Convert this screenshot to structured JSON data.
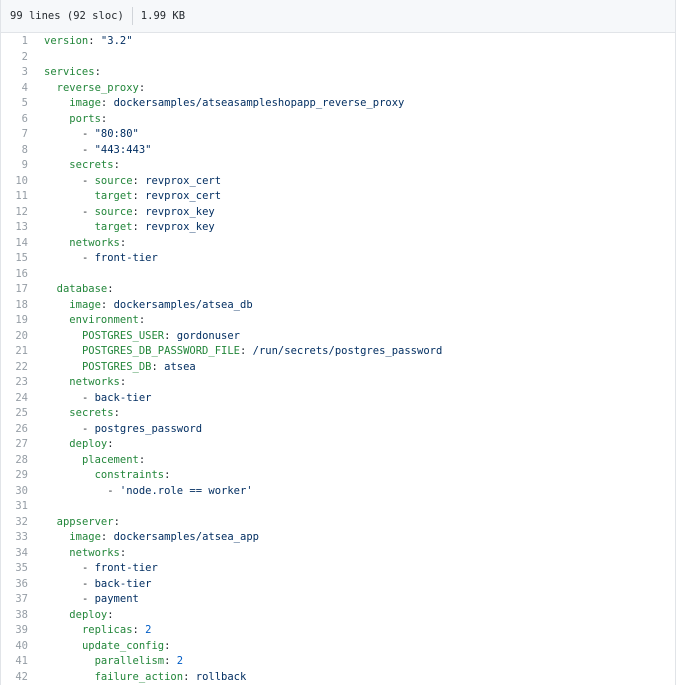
{
  "file_info": {
    "lines": "99 lines (92 sloc)",
    "size": "1.99 KB"
  },
  "colors": {
    "key": "#22863a",
    "string": "#032f62",
    "number": "#005cc5",
    "line_number": "#959da5",
    "header_bg": "#f6f8fa"
  },
  "lines": [
    {
      "n": "1",
      "indent": 0,
      "dash": false,
      "key": "version",
      "sep": ": ",
      "val": "\"3.2\"",
      "vt": "s"
    },
    {
      "n": "2",
      "indent": 0,
      "dash": false,
      "key": "",
      "sep": "",
      "val": "",
      "vt": "s"
    },
    {
      "n": "3",
      "indent": 0,
      "dash": false,
      "key": "services",
      "sep": ":",
      "val": "",
      "vt": "s"
    },
    {
      "n": "4",
      "indent": 2,
      "dash": false,
      "key": "reverse_proxy",
      "sep": ":",
      "val": "",
      "vt": "s"
    },
    {
      "n": "5",
      "indent": 4,
      "dash": false,
      "key": "image",
      "sep": ": ",
      "val": "dockersamples/atseasampleshopapp_reverse_proxy",
      "vt": "s"
    },
    {
      "n": "6",
      "indent": 4,
      "dash": false,
      "key": "ports",
      "sep": ":",
      "val": "",
      "vt": "s"
    },
    {
      "n": "7",
      "indent": 6,
      "dash": true,
      "key": "",
      "sep": "",
      "val": "\"80:80\"",
      "vt": "s"
    },
    {
      "n": "8",
      "indent": 6,
      "dash": true,
      "key": "",
      "sep": "",
      "val": "\"443:443\"",
      "vt": "s"
    },
    {
      "n": "9",
      "indent": 4,
      "dash": false,
      "key": "secrets",
      "sep": ":",
      "val": "",
      "vt": "s"
    },
    {
      "n": "10",
      "indent": 6,
      "dash": true,
      "key": "source",
      "sep": ": ",
      "val": "revprox_cert",
      "vt": "s"
    },
    {
      "n": "11",
      "indent": 8,
      "dash": false,
      "key": "target",
      "sep": ": ",
      "val": "revprox_cert",
      "vt": "s"
    },
    {
      "n": "12",
      "indent": 6,
      "dash": true,
      "key": "source",
      "sep": ": ",
      "val": "revprox_key",
      "vt": "s"
    },
    {
      "n": "13",
      "indent": 8,
      "dash": false,
      "key": "target",
      "sep": ": ",
      "val": "revprox_key",
      "vt": "s"
    },
    {
      "n": "14",
      "indent": 4,
      "dash": false,
      "key": "networks",
      "sep": ":",
      "val": "",
      "vt": "s"
    },
    {
      "n": "15",
      "indent": 6,
      "dash": true,
      "key": "",
      "sep": "",
      "val": "front-tier",
      "vt": "s"
    },
    {
      "n": "16",
      "indent": 0,
      "dash": false,
      "key": "",
      "sep": "",
      "val": "",
      "vt": "s"
    },
    {
      "n": "17",
      "indent": 2,
      "dash": false,
      "key": "database",
      "sep": ":",
      "val": "",
      "vt": "s"
    },
    {
      "n": "18",
      "indent": 4,
      "dash": false,
      "key": "image",
      "sep": ": ",
      "val": "dockersamples/atsea_db",
      "vt": "s"
    },
    {
      "n": "19",
      "indent": 4,
      "dash": false,
      "key": "environment",
      "sep": ":",
      "val": "",
      "vt": "s"
    },
    {
      "n": "20",
      "indent": 6,
      "dash": false,
      "key": "POSTGRES_USER",
      "sep": ": ",
      "val": "gordonuser",
      "vt": "s"
    },
    {
      "n": "21",
      "indent": 6,
      "dash": false,
      "key": "POSTGRES_DB_PASSWORD_FILE",
      "sep": ": ",
      "val": "/run/secrets/postgres_password",
      "vt": "s"
    },
    {
      "n": "22",
      "indent": 6,
      "dash": false,
      "key": "POSTGRES_DB",
      "sep": ": ",
      "val": "atsea",
      "vt": "s"
    },
    {
      "n": "23",
      "indent": 4,
      "dash": false,
      "key": "networks",
      "sep": ":",
      "val": "",
      "vt": "s"
    },
    {
      "n": "24",
      "indent": 6,
      "dash": true,
      "key": "",
      "sep": "",
      "val": "back-tier",
      "vt": "s"
    },
    {
      "n": "25",
      "indent": 4,
      "dash": false,
      "key": "secrets",
      "sep": ":",
      "val": "",
      "vt": "s"
    },
    {
      "n": "26",
      "indent": 6,
      "dash": true,
      "key": "",
      "sep": "",
      "val": "postgres_password",
      "vt": "s"
    },
    {
      "n": "27",
      "indent": 4,
      "dash": false,
      "key": "deploy",
      "sep": ":",
      "val": "",
      "vt": "s"
    },
    {
      "n": "28",
      "indent": 6,
      "dash": false,
      "key": "placement",
      "sep": ":",
      "val": "",
      "vt": "s"
    },
    {
      "n": "29",
      "indent": 8,
      "dash": false,
      "key": "constraints",
      "sep": ":",
      "val": "",
      "vt": "s"
    },
    {
      "n": "30",
      "indent": 10,
      "dash": true,
      "key": "",
      "sep": "",
      "val": "'node.role == worker'",
      "vt": "s"
    },
    {
      "n": "31",
      "indent": 0,
      "dash": false,
      "key": "",
      "sep": "",
      "val": "",
      "vt": "s"
    },
    {
      "n": "32",
      "indent": 2,
      "dash": false,
      "key": "appserver",
      "sep": ":",
      "val": "",
      "vt": "s"
    },
    {
      "n": "33",
      "indent": 4,
      "dash": false,
      "key": "image",
      "sep": ": ",
      "val": "dockersamples/atsea_app",
      "vt": "s"
    },
    {
      "n": "34",
      "indent": 4,
      "dash": false,
      "key": "networks",
      "sep": ":",
      "val": "",
      "vt": "s"
    },
    {
      "n": "35",
      "indent": 6,
      "dash": true,
      "key": "",
      "sep": "",
      "val": "front-tier",
      "vt": "s"
    },
    {
      "n": "36",
      "indent": 6,
      "dash": true,
      "key": "",
      "sep": "",
      "val": "back-tier",
      "vt": "s"
    },
    {
      "n": "37",
      "indent": 6,
      "dash": true,
      "key": "",
      "sep": "",
      "val": "payment",
      "vt": "s"
    },
    {
      "n": "38",
      "indent": 4,
      "dash": false,
      "key": "deploy",
      "sep": ":",
      "val": "",
      "vt": "s"
    },
    {
      "n": "39",
      "indent": 6,
      "dash": false,
      "key": "replicas",
      "sep": ": ",
      "val": "2",
      "vt": "n"
    },
    {
      "n": "40",
      "indent": 6,
      "dash": false,
      "key": "update_config",
      "sep": ":",
      "val": "",
      "vt": "s"
    },
    {
      "n": "41",
      "indent": 8,
      "dash": false,
      "key": "parallelism",
      "sep": ": ",
      "val": "2",
      "vt": "n"
    },
    {
      "n": "42",
      "indent": 8,
      "dash": false,
      "key": "failure_action",
      "sep": ": ",
      "val": "rollback",
      "vt": "s"
    }
  ]
}
